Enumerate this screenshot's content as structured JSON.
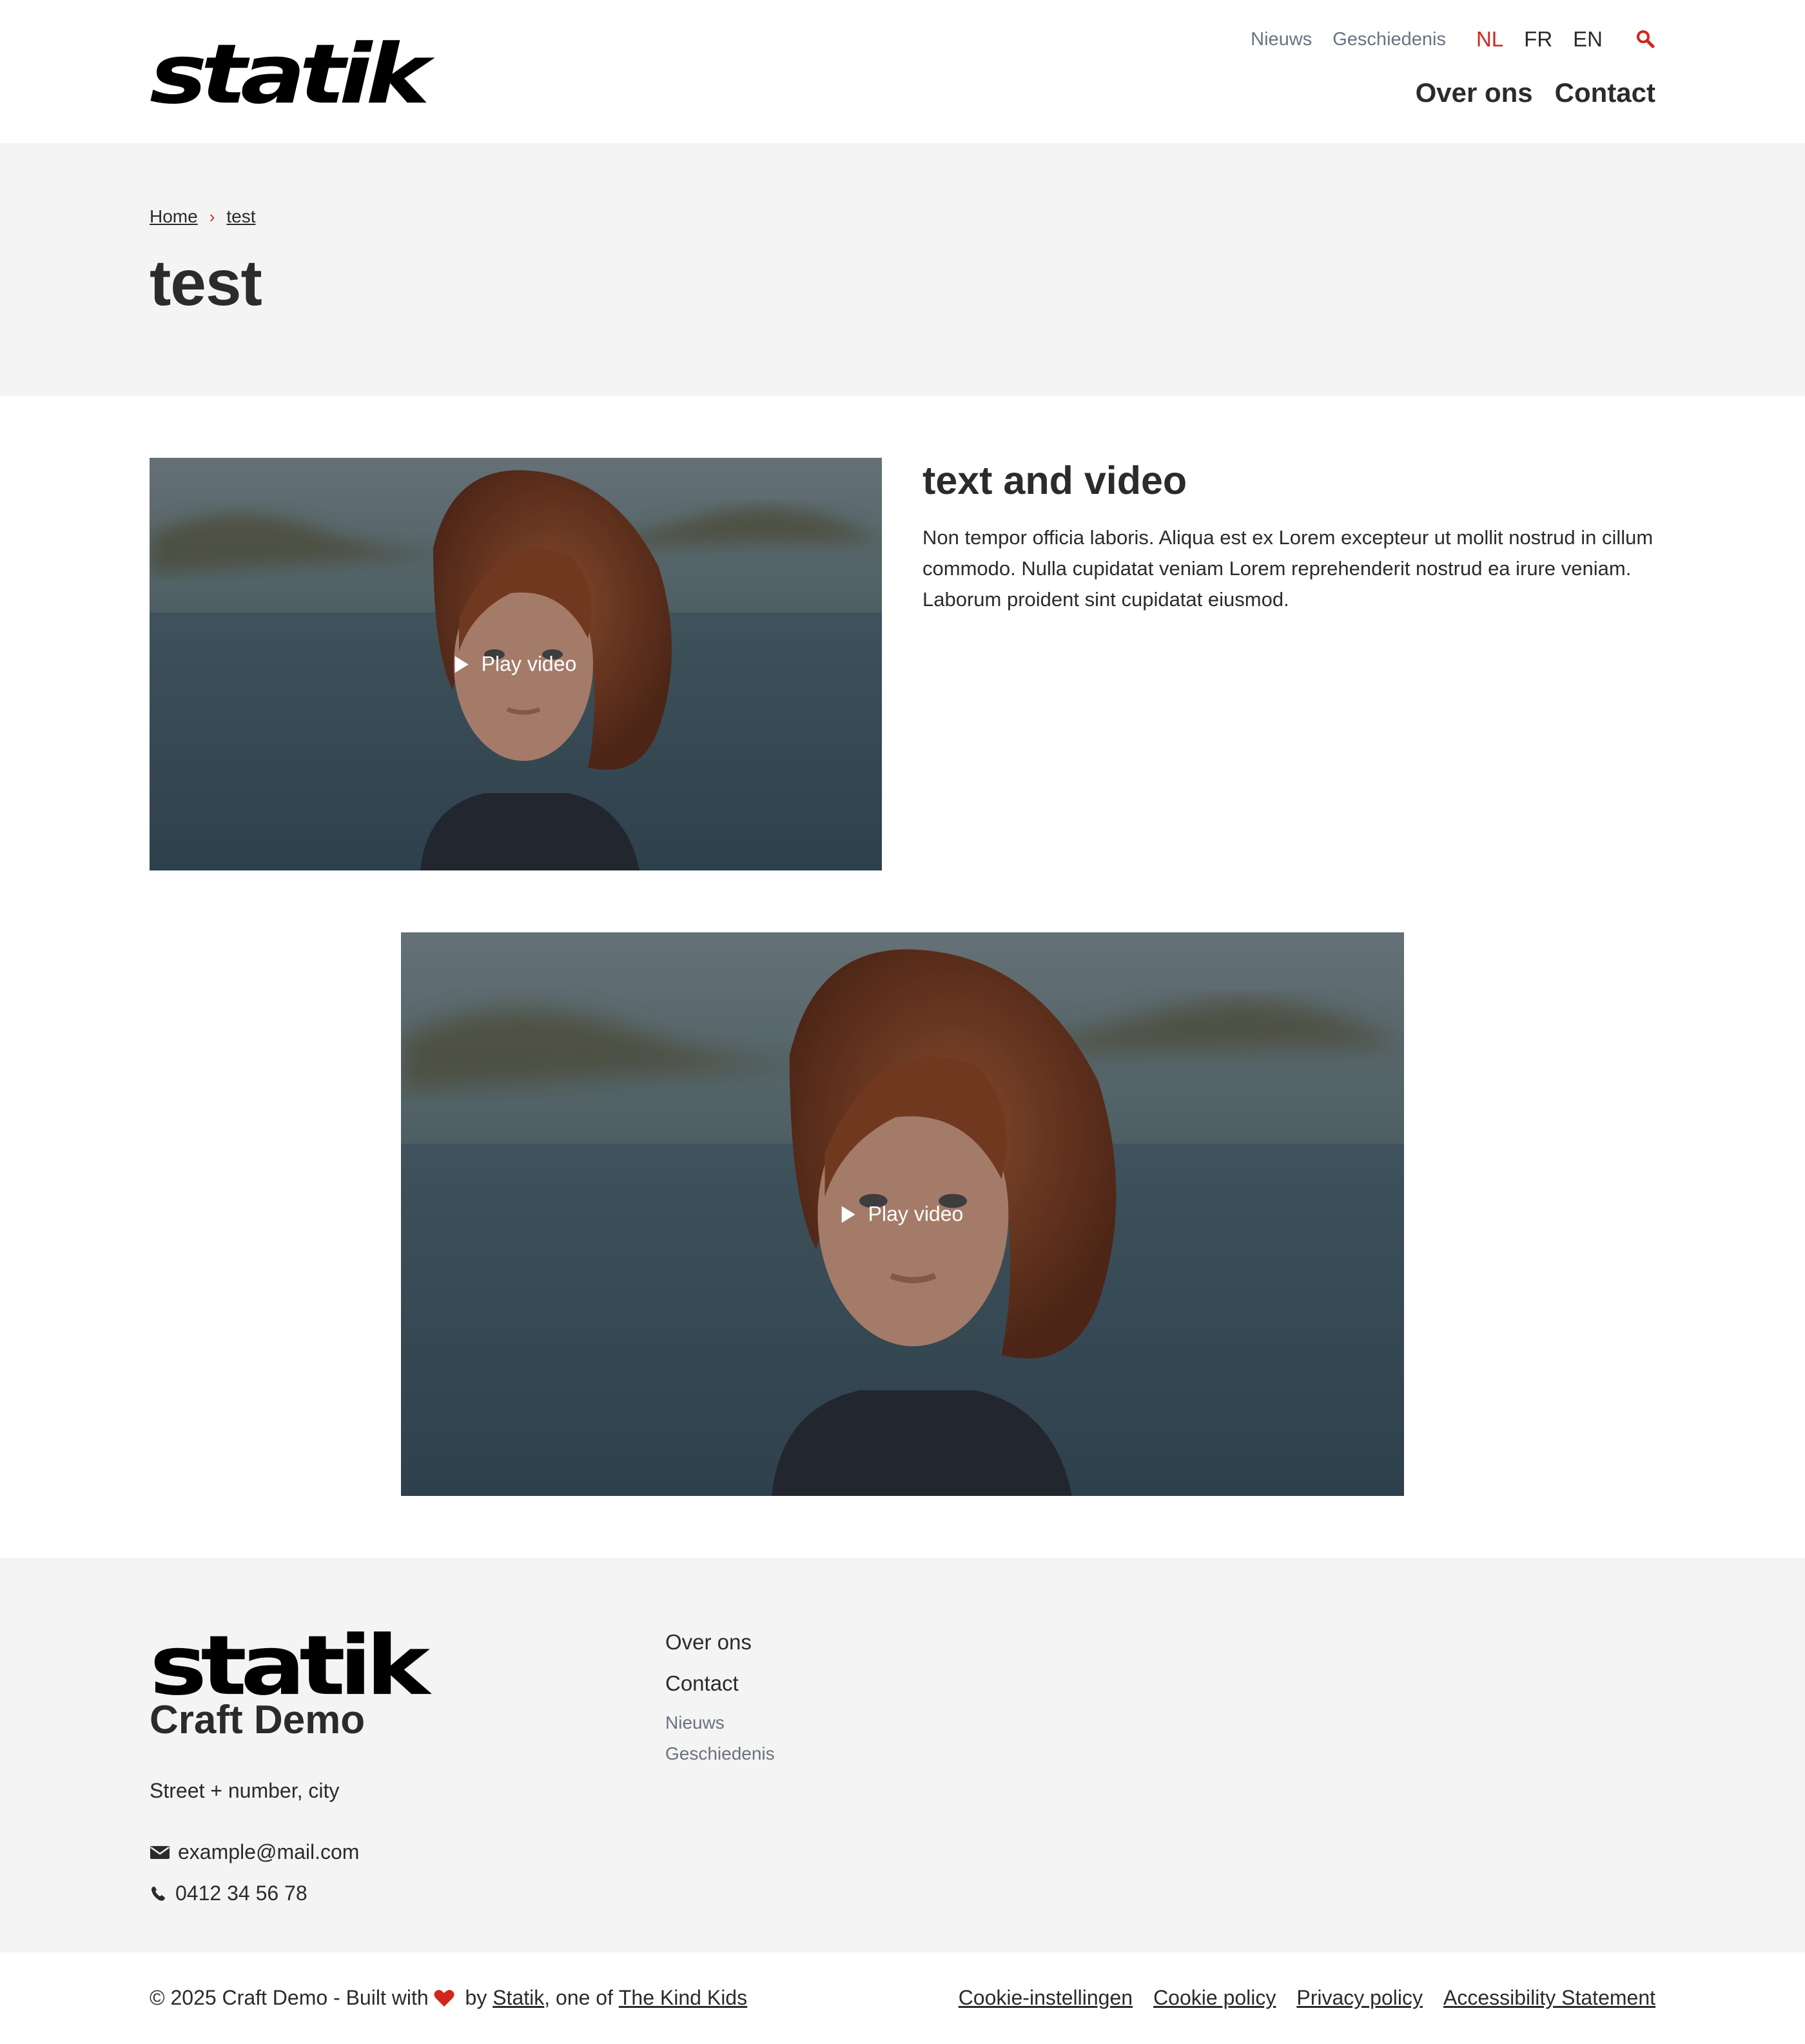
{
  "header": {
    "logo_text": "statik",
    "top_links": [
      "Nieuws",
      "Geschiedenis"
    ],
    "languages": [
      {
        "code": "NL",
        "active": true
      },
      {
        "code": "FR",
        "active": false
      },
      {
        "code": "EN",
        "active": false
      }
    ],
    "search_icon": "search-icon",
    "main_nav": [
      "Over ons",
      "Contact"
    ],
    "accent_color": "#d0261b"
  },
  "hero": {
    "breadcrumb": [
      "Home",
      "test"
    ],
    "title": "test"
  },
  "text_video": {
    "title": "text and video",
    "body": "Non tempor officia laboris. Aliqua est ex Lorem excepteur ut mollit nostrud in cillum commodo. Nulla cupidatat veniam Lorem reprehenderit nostrud ea irure veniam. Laborum proident sint cupidatat eiusmod.",
    "play_label": "Play video"
  },
  "full_video": {
    "play_label": "Play video"
  },
  "footer": {
    "logo_text": "statik",
    "brand": "Craft Demo",
    "address": "Street + number, city",
    "email": "example@mail.com",
    "phone": "0412 34 56 78",
    "nav_main": [
      "Over ons",
      "Contact"
    ],
    "nav_secondary": [
      "Nieuws",
      "Geschiedenis"
    ]
  },
  "bottom": {
    "copyright_prefix": "© 2025 Craft Demo - Built with",
    "by": " by ",
    "statik_link": "Statik",
    "one_of": ", one of ",
    "kind_kids_link": "The Kind Kids",
    "legal_links": [
      "Cookie-instellingen",
      "Cookie policy",
      "Privacy policy",
      "Accessibility Statement"
    ]
  }
}
